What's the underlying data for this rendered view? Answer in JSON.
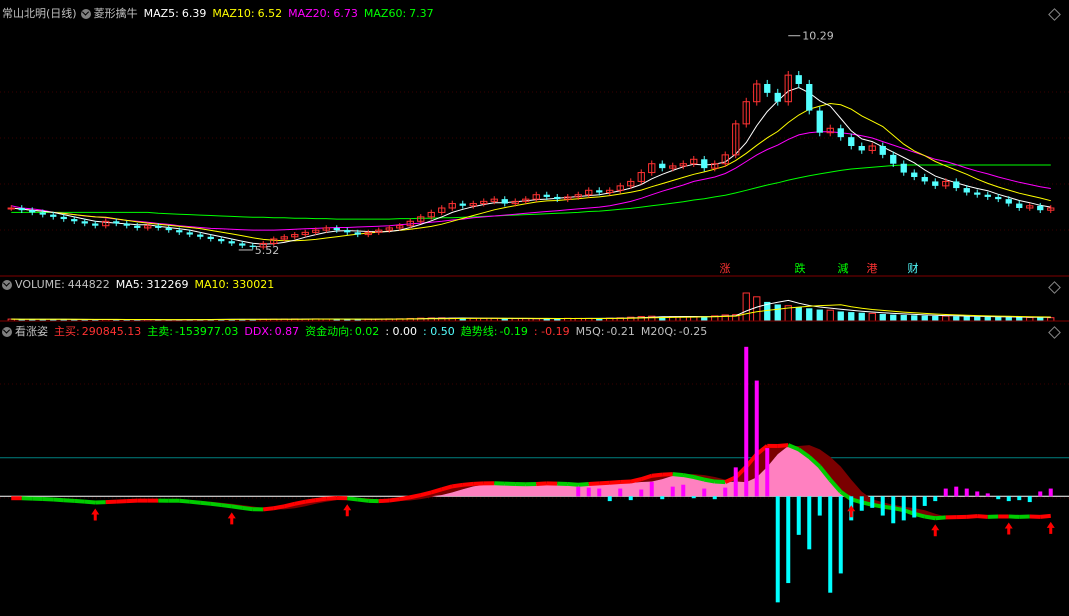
{
  "main_header": {
    "stock": "常山北明(日线)",
    "indicator": "菱形擒牛",
    "maz5_label": "MAZ5:",
    "maz5": "6.39",
    "maz10_label": "MAZ10:",
    "maz10": "6.52",
    "maz20_label": "MAZ20:",
    "maz20": "6.73",
    "maz60_label": "MAZ60:",
    "maz60": "7.37"
  },
  "vol_header": {
    "volume_label": "VOLUME:",
    "volume": "444822",
    "ma5_label": "MA5:",
    "ma5": "312269",
    "ma10_label": "MA10:",
    "ma10": "330021"
  },
  "ind_header": {
    "name": "看涨姿",
    "zhumai_label": "主买:",
    "zhumai": "290845.13",
    "zhumai2_label": "主卖:",
    "zhumai2": "-153977.03",
    "ddx_label": "DDX:",
    "ddx": "0.87",
    "zjdx_label": "资金动向:",
    "zjdx": "0.02",
    "v1": ": 0.00",
    "v2": ": 0.50",
    "qsx_label": "趋势线:",
    "qsx": "-0.19",
    "v3": ": -0.19",
    "m5q_label": "M5Q:",
    "m5q": "-0.21",
    "m20q_label": "M20Q:",
    "m20q": "-0.25"
  },
  "annotations": {
    "high": "10.29",
    "low": "5.52",
    "signals": [
      "涨",
      "跌",
      "減",
      "港",
      "财"
    ]
  },
  "colors": {
    "up": "#ff3232",
    "down": "#54ffff",
    "ma5": "#ffffff",
    "ma10": "#ffff00",
    "ma20": "#ff00ff",
    "ma60": "#00ff00",
    "darkred": "#7a0000",
    "pink": "#ff80c0"
  },
  "chart_data": {
    "type": "candlestick",
    "closes": [
      6.4,
      6.35,
      6.3,
      6.25,
      6.2,
      6.15,
      6.1,
      6.05,
      6.0,
      6.1,
      6.05,
      6.0,
      5.95,
      6.0,
      5.95,
      5.9,
      5.85,
      5.8,
      5.75,
      5.7,
      5.65,
      5.6,
      5.55,
      5.52,
      5.6,
      5.7,
      5.75,
      5.8,
      5.85,
      5.9,
      5.95,
      5.9,
      5.85,
      5.8,
      5.85,
      5.9,
      5.95,
      6.0,
      6.1,
      6.2,
      6.3,
      6.4,
      6.5,
      6.45,
      6.5,
      6.55,
      6.6,
      6.5,
      6.55,
      6.6,
      6.7,
      6.65,
      6.6,
      6.65,
      6.7,
      6.8,
      6.75,
      6.8,
      6.9,
      7.0,
      7.2,
      7.4,
      7.3,
      7.35,
      7.4,
      7.5,
      7.3,
      7.4,
      7.6,
      8.3,
      8.8,
      9.2,
      9.0,
      8.8,
      9.4,
      9.2,
      8.6,
      8.1,
      8.2,
      8.0,
      7.8,
      7.7,
      7.8,
      7.6,
      7.4,
      7.2,
      7.1,
      7.0,
      6.9,
      7.0,
      6.85,
      6.75,
      6.7,
      6.65,
      6.6,
      6.5,
      6.4,
      6.45,
      6.35,
      6.4
    ],
    "ylim": [
      5.0,
      10.6
    ],
    "maz20": [
      6.45,
      6.4,
      6.38,
      6.35,
      6.3,
      6.28,
      6.25,
      6.22,
      6.2,
      6.18,
      6.15,
      6.12,
      6.1,
      6.08,
      6.05,
      6.03,
      6.0,
      5.98,
      5.96,
      5.94,
      5.93,
      5.92,
      5.91,
      5.9,
      5.9,
      5.9,
      5.91,
      5.92,
      5.93,
      5.94,
      5.95,
      5.96,
      5.96,
      5.97,
      5.98,
      5.99,
      6.0,
      6.02,
      6.04,
      6.06,
      6.08,
      6.1,
      6.13,
      6.15,
      6.18,
      6.2,
      6.22,
      6.24,
      6.26,
      6.28,
      6.3,
      6.32,
      6.34,
      6.36,
      6.38,
      6.4,
      6.42,
      6.45,
      6.5,
      6.55,
      6.62,
      6.7,
      6.78,
      6.85,
      6.92,
      7.0,
      7.05,
      7.1,
      7.18,
      7.3,
      7.45,
      7.6,
      7.72,
      7.82,
      7.95,
      8.05,
      8.1,
      8.12,
      8.12,
      8.1,
      8.07,
      8.03,
      7.98,
      7.9,
      7.82,
      7.74,
      7.66,
      7.58,
      7.5,
      7.45,
      7.38,
      7.3,
      7.23,
      7.17,
      7.1,
      7.04,
      6.98,
      6.93,
      6.88,
      6.84
    ],
    "maz60": [
      6.3,
      6.3,
      6.3,
      6.3,
      6.3,
      6.3,
      6.3,
      6.3,
      6.3,
      6.3,
      6.3,
      6.3,
      6.3,
      6.3,
      6.28,
      6.27,
      6.26,
      6.25,
      6.24,
      6.23,
      6.22,
      6.21,
      6.2,
      6.19,
      6.19,
      6.18,
      6.18,
      6.17,
      6.17,
      6.16,
      6.16,
      6.15,
      6.15,
      6.15,
      6.15,
      6.15,
      6.15,
      6.16,
      6.16,
      6.17,
      6.17,
      6.18,
      6.18,
      6.19,
      6.2,
      6.21,
      6.22,
      6.23,
      6.24,
      6.25,
      6.26,
      6.27,
      6.28,
      6.29,
      6.3,
      6.32,
      6.33,
      6.35,
      6.37,
      6.39,
      6.42,
      6.45,
      6.48,
      6.51,
      6.54,
      6.58,
      6.61,
      6.65,
      6.69,
      6.74,
      6.8,
      6.86,
      6.92,
      6.97,
      7.03,
      7.08,
      7.13,
      7.17,
      7.21,
      7.25,
      7.28,
      7.3,
      7.32,
      7.34,
      7.36,
      7.37,
      7.37,
      7.37,
      7.37,
      7.37,
      7.37,
      7.37,
      7.37,
      7.37,
      7.37,
      7.37,
      7.37,
      7.37,
      7.37,
      7.37
    ],
    "volume": [
      30,
      28,
      26,
      25,
      27,
      24,
      22,
      25,
      23,
      22,
      24,
      21,
      20,
      22,
      21,
      20,
      22,
      23,
      25,
      26,
      28,
      30,
      29,
      27,
      26,
      28,
      30,
      32,
      31,
      33,
      30,
      29,
      28,
      27,
      29,
      31,
      33,
      35,
      40,
      45,
      48,
      50,
      46,
      44,
      42,
      41,
      40,
      39,
      38,
      37,
      36,
      38,
      40,
      42,
      41,
      40,
      42,
      44,
      50,
      60,
      70,
      75,
      72,
      68,
      65,
      70,
      72,
      80,
      95,
      100,
      440,
      380,
      300,
      260,
      240,
      220,
      200,
      180,
      170,
      150,
      140,
      130,
      120,
      110,
      100,
      95,
      90,
      85,
      80,
      78,
      75,
      70,
      68,
      65,
      62,
      60,
      58,
      56,
      55,
      52
    ],
    "ddx_bars": [
      0,
      0,
      0,
      0,
      0,
      0,
      0,
      0,
      0,
      0,
      0,
      0,
      0,
      0,
      0,
      0,
      0,
      0,
      0,
      0,
      0,
      0,
      0,
      0,
      0,
      0,
      0,
      0,
      0,
      0,
      0,
      0,
      0,
      0,
      0,
      0,
      0,
      0,
      0,
      0,
      0,
      0,
      0,
      0,
      0,
      0,
      0,
      0,
      0,
      0,
      0,
      0,
      0,
      0,
      10,
      9,
      8,
      -5,
      8,
      -4,
      7,
      15,
      -3,
      10,
      12,
      -2,
      8,
      -3,
      9,
      30,
      155,
      120,
      50,
      -110,
      -90,
      -40,
      -55,
      -20,
      -100,
      -80,
      -25,
      -15,
      -12,
      -20,
      -28,
      -25,
      -22,
      -10,
      -5,
      8,
      10,
      8,
      5,
      3,
      -3,
      -5,
      -4,
      -6,
      5,
      8
    ],
    "ind_ylim": [
      -120,
      160
    ]
  }
}
